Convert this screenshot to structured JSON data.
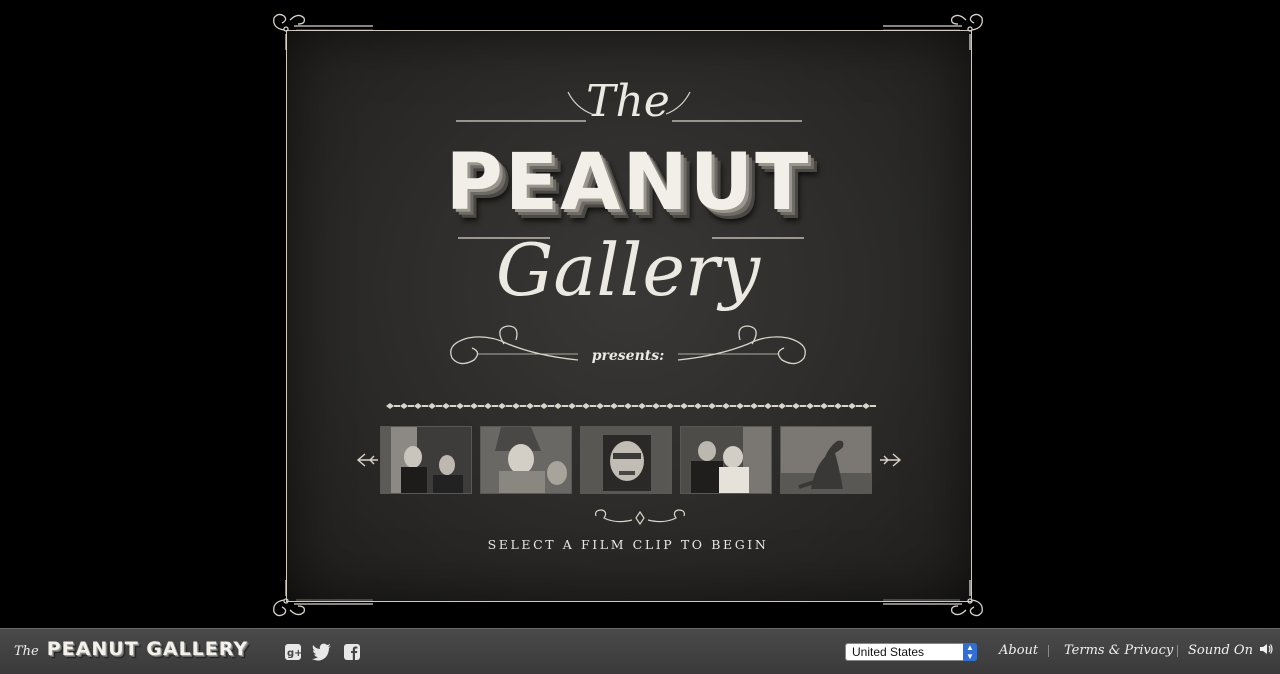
{
  "title": {
    "the": "The",
    "peanut": "PEANUT",
    "gallery": "Gallery",
    "presents": "presents:"
  },
  "clips": {
    "instruction": "SELECT A FILM CLIP TO BEGIN",
    "items": [
      {
        "name": "film-clip-1"
      },
      {
        "name": "film-clip-2"
      },
      {
        "name": "film-clip-3"
      },
      {
        "name": "film-clip-4"
      },
      {
        "name": "film-clip-5"
      }
    ]
  },
  "footer": {
    "logo_the": "The",
    "logo_name": "PEANUT GALLERY",
    "social_icons": [
      "google-plus-icon",
      "twitter-icon",
      "facebook-icon"
    ],
    "country_select": "United States",
    "about": "About",
    "terms": "Terms & Privacy",
    "sound": "Sound On"
  },
  "colors": {
    "background": "#000000",
    "panel": "#2b2a28",
    "ink": "#ece9e2",
    "footer": "#444444",
    "select_accent": "#2f6fd6"
  }
}
